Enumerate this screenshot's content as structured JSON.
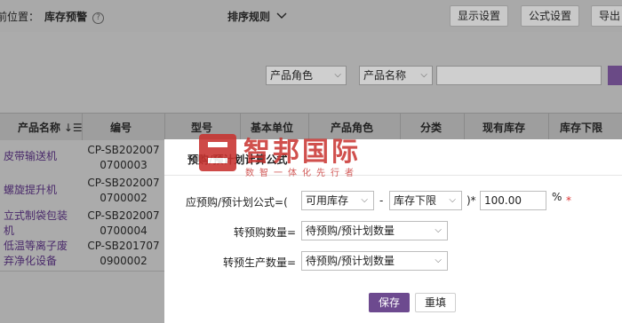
{
  "breadcrumb": {
    "prefix": "前位置：",
    "current": "库存预警",
    "help_icon": "?"
  },
  "sort_rule": {
    "label": "排序规则",
    "icon": "chevron-down-icon"
  },
  "toolbar": {
    "display_settings": "显示设置",
    "formula_settings": "公式设置",
    "export": "导出"
  },
  "filters": {
    "role_select": "产品角色",
    "name_select": "产品名称",
    "search_value": ""
  },
  "table": {
    "columns": [
      "产品名称",
      "编号",
      "型号",
      "基本单位",
      "产品角色",
      "分类",
      "现有库存",
      "库存下限"
    ],
    "rows": [
      {
        "name": "皮带输送机",
        "code": "CP-SB2020070700003"
      },
      {
        "name": "螺旋提升机",
        "code": "CP-SB2020070700002"
      },
      {
        "name": "立式制袋包装机",
        "code": "CP-SB2020070700004"
      },
      {
        "name": "低温等离子废弃净化设备",
        "code": "CP-SB2017070900002"
      }
    ]
  },
  "rows_display": [
    {
      "name_lines": [
        "皮带输送机"
      ],
      "code_lines": [
        "CP-SB202007",
        "0700003"
      ]
    },
    {
      "name_lines": [
        "螺旋提升机"
      ],
      "code_lines": [
        "CP-SB202007",
        "0700002"
      ]
    },
    {
      "name_lines": [
        "立式制袋包装",
        "机"
      ],
      "code_lines": [
        "CP-SB202007",
        "0700004"
      ]
    },
    {
      "name_lines": [
        "低温等离子废",
        "弃净化设备"
      ],
      "code_lines": [
        "CP-SB201707",
        "0900002"
      ]
    }
  ],
  "dialog": {
    "title": "预购/预计划计算公式",
    "formula_label": "应预购/预计划公式=(",
    "operand1": "可用库存",
    "minus": "-",
    "operand2": "库存下限",
    "multiply": ")*",
    "factor": "100.00",
    "percent": "%",
    "required": "*",
    "purchase_label": "转预购数量=",
    "purchase_value": "待预购/预计划数量",
    "production_label": "转预生产数量=",
    "production_value": "待预购/预计划数量",
    "save": "保存",
    "reset": "重填"
  },
  "watermark": {
    "title": "智邦国际",
    "subtitle": "数智一体化先行者"
  },
  "colors": {
    "accent": "#6d4a8f",
    "watermark": "#c8322f"
  }
}
